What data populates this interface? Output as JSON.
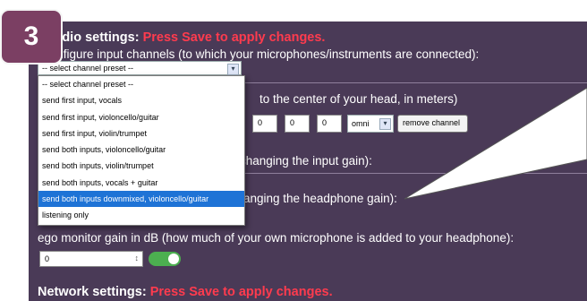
{
  "step_badge": "3",
  "audio": {
    "heading": "Audio settings:",
    "heading_warning": "Press Save to apply changes.",
    "configure_text": "Configure input channels (to which your microphones/instruments are connected):",
    "preset_select_value": "-- select channel preset --",
    "preset_options": [
      "-- select channel preset --",
      "send first input, vocals",
      "send first input, violoncello/guitar",
      "send first input, violin/trumpet",
      "send both inputs, violoncello/guitar",
      "send both inputs, violin/trumpet",
      "send both inputs, vocals + guitar",
      "send both inputs downmixed, violoncello/guitar",
      "listening only"
    ],
    "selected_option_index": 7,
    "position_text": "to the center of your head, in meters)",
    "coord_x": "0",
    "coord_y": "0",
    "coord_z": "0",
    "directivity_value": "omni",
    "remove_channel_label": "remove channel",
    "input_gain_text": "changing the input gain):",
    "headphone_gain_text": "anging the headphone gain):",
    "ego_monitor_text": "ego monitor gain in dB (how much of your own microphone is added to your headphone):",
    "ego_monitor_value": "0",
    "ego_monitor_enabled": true
  },
  "network": {
    "heading": "Network settings:",
    "heading_warning": "Press Save to apply changes."
  },
  "colors": {
    "panel": "#4a3a57",
    "warning": "#ff3b4e",
    "highlight": "#1e73d6",
    "toggle_on": "#4caf50",
    "badge": "#7b3f63"
  }
}
